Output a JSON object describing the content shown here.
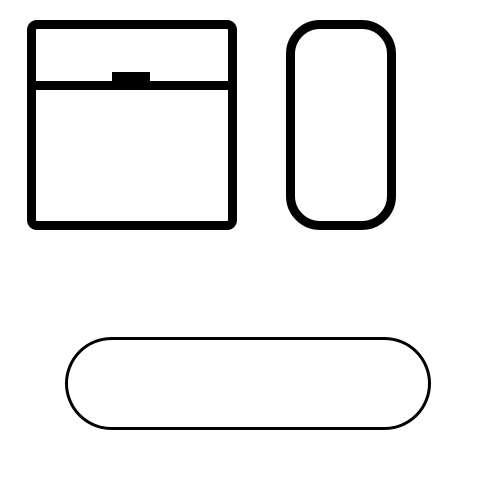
{
  "colors": {
    "stroke": "#000000",
    "background": "#ffffff"
  },
  "shapes": [
    {
      "id": "box",
      "kind": "square-with-lid"
    },
    {
      "id": "tall-pill",
      "kind": "tall-rounded-rectangle"
    },
    {
      "id": "wide-capsule",
      "kind": "wide-capsule"
    }
  ]
}
